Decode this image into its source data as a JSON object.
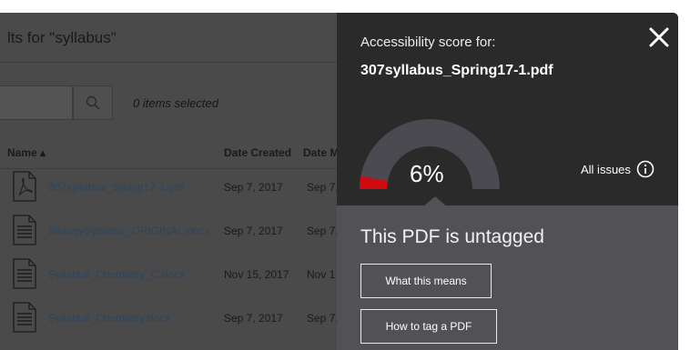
{
  "browser": {
    "results_title": "lts for \"syllabus\"",
    "items_selected": "0 items selected",
    "search_icon": "search-icon",
    "columns": {
      "name": "Name ▴",
      "date_created": "Date Created",
      "date_modified": "Date M"
    },
    "files": [
      {
        "name": "307syllabus_Spring17-1.pdf",
        "created": "Sep 7, 2017",
        "modified": "Sep 7,",
        "icon": "pdf-file-icon"
      },
      {
        "name": "BiologySyllabus_ORIGINAL.docx",
        "created": "Sep 7, 2017",
        "modified": "Sep 7,",
        "icon": "document-file-icon"
      },
      {
        "name": "Syllabus_Chemistry_C.docx",
        "created": "Nov 15, 2017",
        "modified": "Nov 1",
        "icon": "document-file-icon"
      },
      {
        "name": "Syllabus_Chemistry.docx",
        "created": "Sep 7, 2017",
        "modified": "Sep 7,",
        "icon": "document-file-icon"
      }
    ]
  },
  "panel": {
    "score_label": "Accessibility score for:",
    "file_name": "307syllabus_Spring17-1.pdf",
    "score_text": "6%",
    "score_value": 6,
    "all_issues_label": "All issues",
    "status_heading": "This PDF is untagged",
    "buttons": {
      "what_this_means": "What this means",
      "how_to_tag": "How to tag a PDF"
    },
    "colors": {
      "gauge_track": "#4a4a50",
      "gauge_fill": "#d10a11",
      "panel_dark": "#2a2a2a",
      "panel_light": "#515156"
    }
  }
}
